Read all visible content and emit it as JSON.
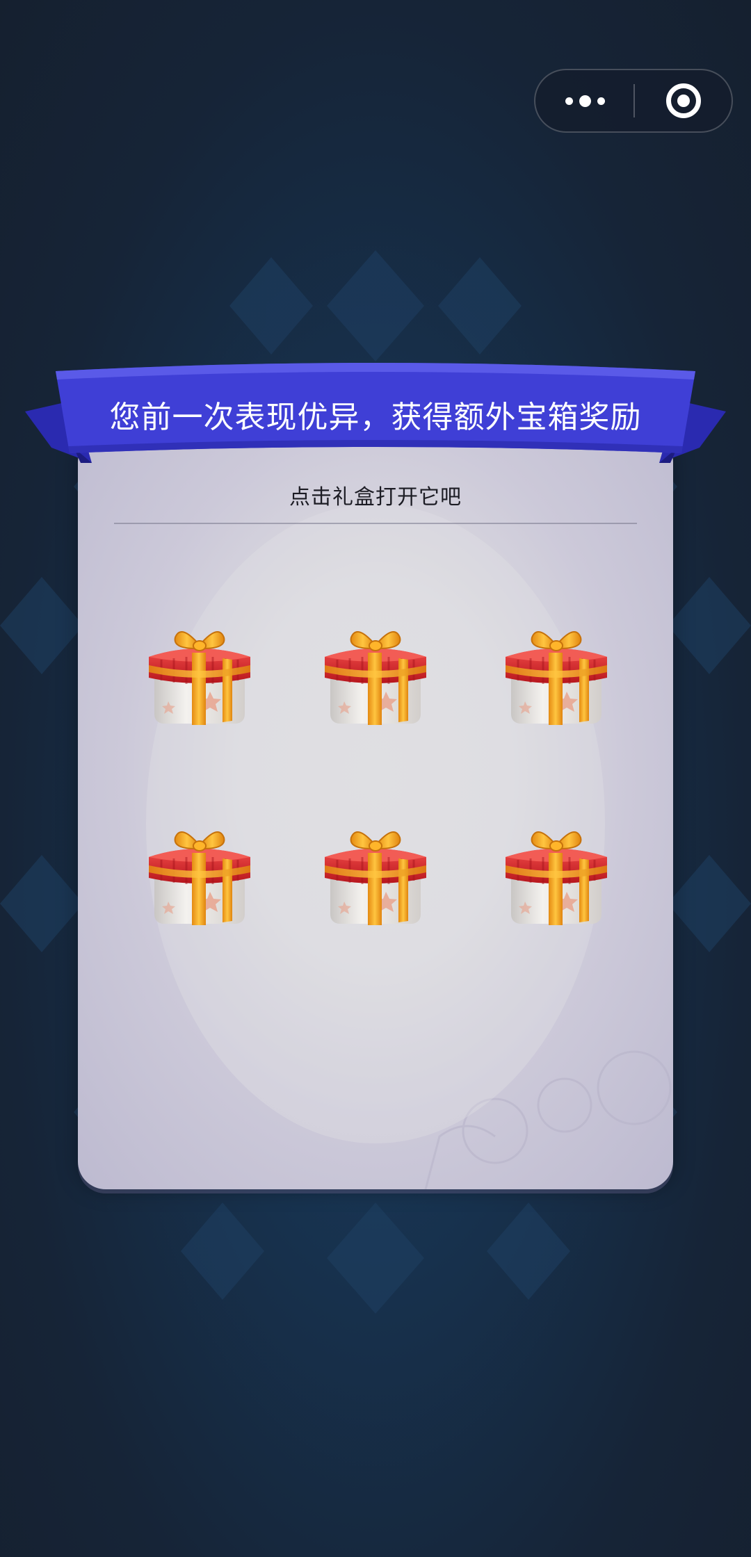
{
  "capsule": {
    "more_icon": "more-dots-icon",
    "close_icon": "target-close-icon"
  },
  "banner": {
    "title": "您前一次表现优异，获得额外宝箱奖励",
    "color": "#3f3fd6"
  },
  "card": {
    "instruction": "点击礼盒打开它吧",
    "gifts": [
      {
        "icon": "gift-box-icon"
      },
      {
        "icon": "gift-box-icon"
      },
      {
        "icon": "gift-box-icon"
      },
      {
        "icon": "gift-box-icon"
      },
      {
        "icon": "gift-box-icon"
      },
      {
        "icon": "gift-box-icon"
      }
    ]
  },
  "colors": {
    "background": "#17263a",
    "banner": "#3f3fd6",
    "gift_red": "#d9262b",
    "ribbon_gold": "#f2a31b"
  }
}
